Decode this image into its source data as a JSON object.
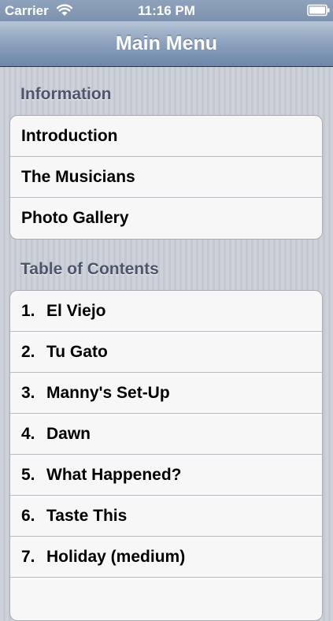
{
  "status_bar": {
    "carrier": "Carrier",
    "time": "11:16 PM",
    "wifi_icon": "wifi-icon",
    "battery_icon": "battery-icon"
  },
  "nav": {
    "title": "Main Menu"
  },
  "sections": {
    "information": {
      "header": "Information",
      "items": [
        "Introduction",
        "The Musicians",
        "Photo Gallery"
      ]
    },
    "toc": {
      "header": "Table of Contents",
      "items": [
        {
          "num": "1.",
          "label": "El Viejo"
        },
        {
          "num": "2.",
          "label": "Tu Gato"
        },
        {
          "num": "3.",
          "label": "Manny's Set-Up"
        },
        {
          "num": "4.",
          "label": "Dawn"
        },
        {
          "num": "5.",
          "label": "What Happened?"
        },
        {
          "num": "6.",
          "label": "Taste This"
        },
        {
          "num": "7.",
          "label": "Holiday (medium)"
        },
        {
          "num": "",
          "label": ""
        }
      ]
    }
  },
  "colors": {
    "nav_gradient_top": "#b6c4d5",
    "nav_gradient_bottom": "#6d87a8",
    "section_header": "#4c566a",
    "cell_background": "#f7f7f7"
  }
}
